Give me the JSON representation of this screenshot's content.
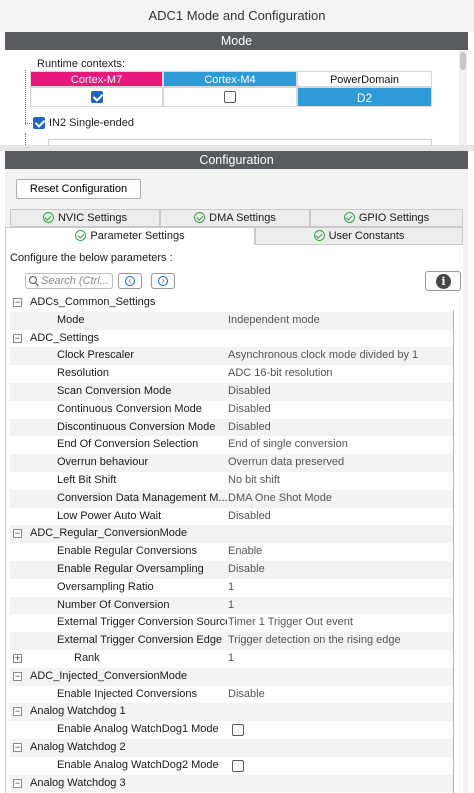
{
  "window": {
    "title": "ADC1 Mode and Configuration"
  },
  "mode": {
    "header": "Mode",
    "runtime_label": "Runtime contexts:",
    "contexts": [
      {
        "label": "Cortex-M7",
        "color": "#e8177b",
        "checked": true
      },
      {
        "label": "Cortex-M4",
        "color": "#2f9ad8",
        "checked": false
      },
      {
        "label": "PowerDomain",
        "color": "#ffffff",
        "value": "D2"
      }
    ],
    "in2_label": "IN2 Single-ended"
  },
  "configuration": {
    "header": "Configuration",
    "reset_button": "Reset Configuration",
    "tabs_row1": [
      "NVIC Settings",
      "DMA Settings",
      "GPIO Settings"
    ],
    "tabs_row2": [
      "Parameter Settings",
      "User Constants"
    ],
    "configure_label": "Configure the below parameters :",
    "search_placeholder": "Search (Ctrl...",
    "tree": [
      {
        "type": "group",
        "label": "ADCs_Common_Settings"
      },
      {
        "type": "param",
        "label": "Mode",
        "value": "Independent mode"
      },
      {
        "type": "group",
        "label": "ADC_Settings"
      },
      {
        "type": "param",
        "label": "Clock Prescaler",
        "value": "Asynchronous clock mode divided by 1"
      },
      {
        "type": "param",
        "label": "Resolution",
        "value": "ADC 16-bit resolution"
      },
      {
        "type": "param",
        "label": "Scan Conversion Mode",
        "value": "Disabled"
      },
      {
        "type": "param",
        "label": "Continuous Conversion Mode",
        "value": "Disabled"
      },
      {
        "type": "param",
        "label": "Discontinuous Conversion Mode",
        "value": "Disabled"
      },
      {
        "type": "param",
        "label": "End Of Conversion Selection",
        "value": "End of single conversion"
      },
      {
        "type": "param",
        "label": "Overrun behaviour",
        "value": "Overrun data preserved"
      },
      {
        "type": "param",
        "label": "Left Bit Shift",
        "value": "No bit shift"
      },
      {
        "type": "param",
        "label": "Conversion Data Management M...",
        "value": "DMA One Shot Mode"
      },
      {
        "type": "param",
        "label": "Low Power Auto Wait",
        "value": "Disabled"
      },
      {
        "type": "group",
        "label": "ADC_Regular_ConversionMode"
      },
      {
        "type": "param",
        "label": "Enable Regular Conversions",
        "value": "Enable"
      },
      {
        "type": "param",
        "label": "Enable Regular Oversampling",
        "value": "Disable"
      },
      {
        "type": "param",
        "label": "Oversampling Ratio",
        "value": "1"
      },
      {
        "type": "param",
        "label": "Number Of Conversion",
        "value": "1"
      },
      {
        "type": "param",
        "label": "External Trigger Conversion Source",
        "value": "Timer 1 Trigger Out event"
      },
      {
        "type": "param",
        "label": "External Trigger Conversion Edge",
        "value": "Trigger detection on the rising edge"
      },
      {
        "type": "subgroup",
        "label": "Rank",
        "value": "1"
      },
      {
        "type": "group",
        "label": "ADC_Injected_ConversionMode"
      },
      {
        "type": "param",
        "label": "Enable Injected Conversions",
        "value": "Disable"
      },
      {
        "type": "group",
        "label": "Analog Watchdog 1"
      },
      {
        "type": "check",
        "label": "Enable Analog WatchDog1 Mode",
        "checked": false
      },
      {
        "type": "group",
        "label": "Analog Watchdog 2"
      },
      {
        "type": "check",
        "label": "Enable Analog WatchDog2 Mode",
        "checked": false
      },
      {
        "type": "group",
        "label": "Analog Watchdog 3"
      }
    ]
  },
  "colors": {
    "accent_blue": "#2f9ad8",
    "accent_pink": "#e8177b",
    "header_bar": "#595b5e",
    "ok_green": "#3aa24a"
  }
}
